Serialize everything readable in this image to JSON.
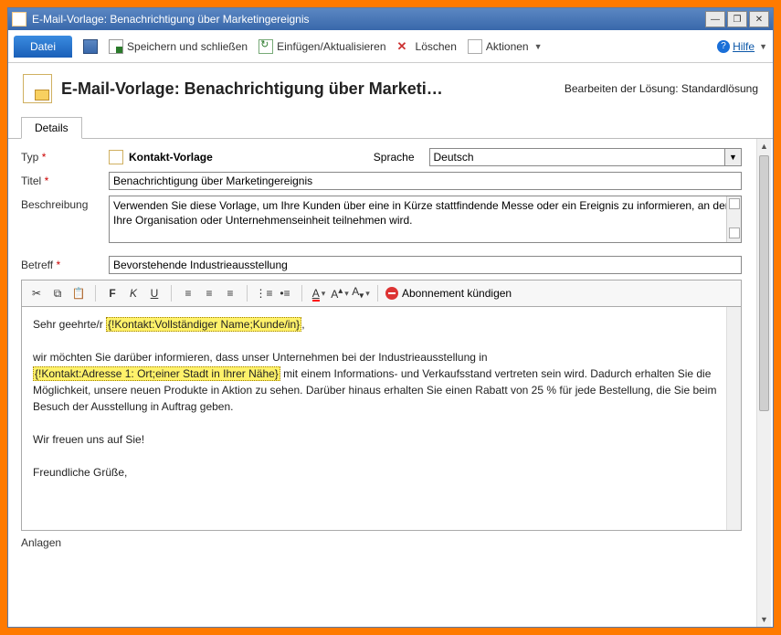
{
  "window": {
    "title": "E-Mail-Vorlage: Benachrichtigung über Marketingereignis"
  },
  "ribbon": {
    "file": "Datei",
    "save_close": "Speichern und schließen",
    "insert_update": "Einfügen/Aktualisieren",
    "delete": "Löschen",
    "actions": "Aktionen",
    "help": "Hilfe"
  },
  "header": {
    "title": "E-Mail-Vorlage: Benachrichtigung über Marketi…",
    "solution": "Bearbeiten der Lösung: Standardlösung"
  },
  "tabs": {
    "details": "Details"
  },
  "form": {
    "type_label": "Typ",
    "type_value": "Kontakt-Vorlage",
    "language_label": "Sprache",
    "language_value": "Deutsch",
    "title_label": "Titel",
    "title_value": "Benachrichtigung über Marketingereignis",
    "description_label": "Beschreibung",
    "description_value": "Verwenden Sie diese Vorlage, um Ihre Kunden über eine in Kürze stattfindende Messe oder ein Ereignis zu informieren, an dem Ihre Organisation oder Unternehmenseinheit teilnehmen wird.",
    "subject_label": "Betreff",
    "subject_value": "Bevorstehende Industrieausstellung",
    "attachments_label": "Anlagen"
  },
  "editor_toolbar": {
    "unsubscribe": "Abonnement kündigen"
  },
  "body": {
    "greeting": "Sehr geehrte/r ",
    "slug1": "{!Kontakt:Vollständiger Name;Kunde/in}",
    "p1a": "wir möchten Sie darüber informieren, dass unser Unternehmen bei der Industrieausstellung in ",
    "slug2": "{!Kontakt:Adresse 1: Ort;einer Stadt in Ihrer Nähe}",
    "p1b": " mit einem Informations- und Verkaufsstand vertreten sein wird. Dadurch erhalten Sie die Möglichkeit, unsere neuen Produkte in Aktion zu sehen. Darüber hinaus erhalten Sie einen Rabatt von 25 % für jede Bestellung, die Sie beim Besuch der Ausstellung in Auftrag geben.",
    "p2": "Wir freuen uns auf Sie!",
    "p3": "Freundliche Grüße,"
  }
}
